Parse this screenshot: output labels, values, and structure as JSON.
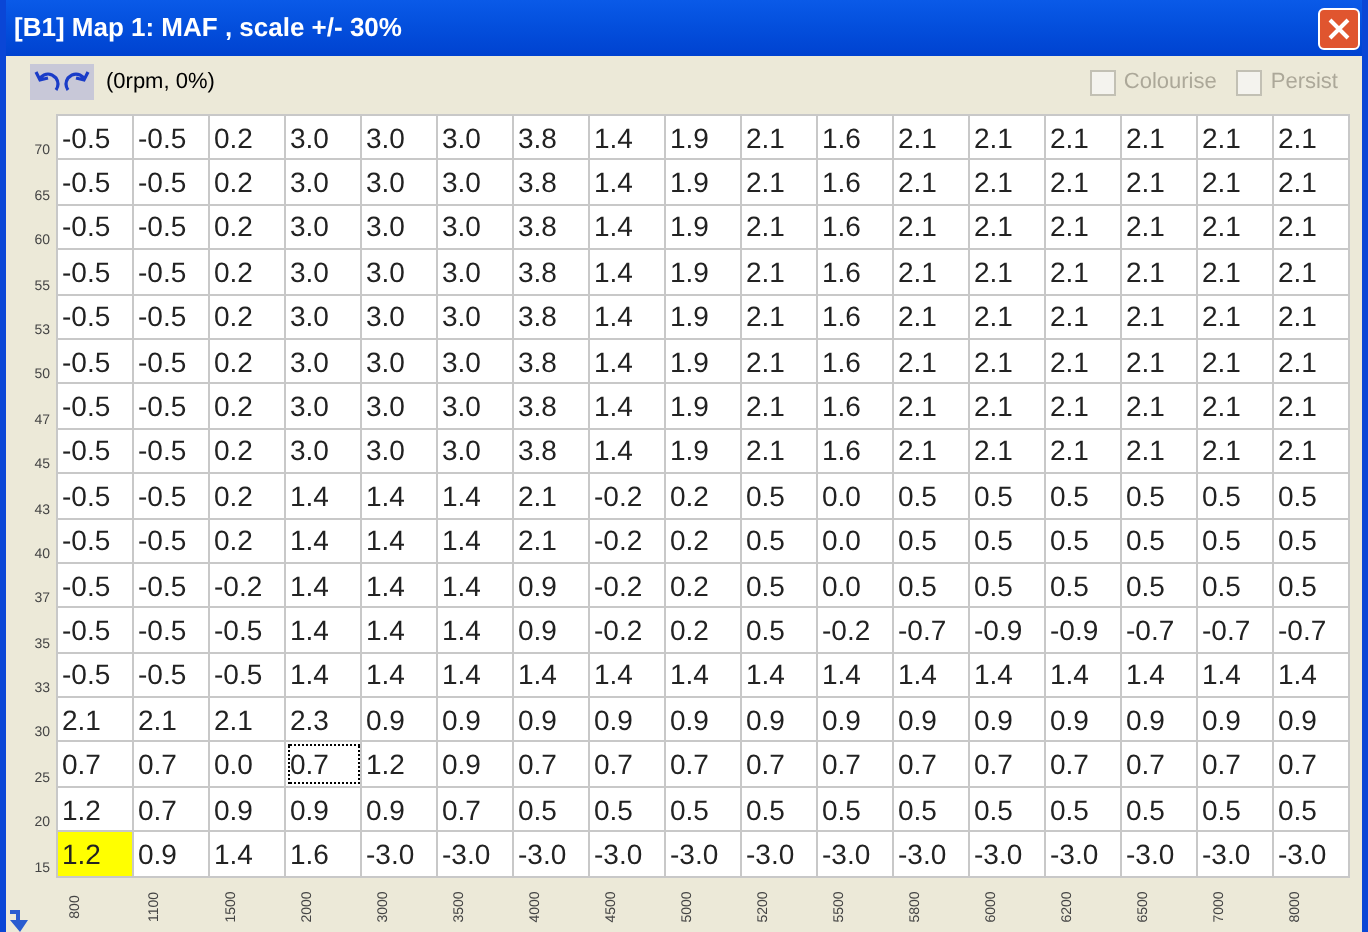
{
  "window": {
    "title": "[B1] Map 1: MAF , scale +/- 30%"
  },
  "toolbar": {
    "position": "(0rpm, 0%)",
    "options": [
      {
        "label": "Colourise",
        "checked": false,
        "disabled": true
      },
      {
        "label": "Persist",
        "checked": false,
        "disabled": true
      }
    ]
  },
  "rows": [
    {
      "label": "70",
      "cells": [
        {
          "text": "-0.5",
          "selected": false,
          "focused": false
        },
        {
          "text": "-0.5",
          "selected": false,
          "focused": false
        },
        {
          "text": "0.2",
          "selected": false,
          "focused": false
        },
        {
          "text": "3.0",
          "selected": false,
          "focused": false
        },
        {
          "text": "3.0",
          "selected": false,
          "focused": false
        },
        {
          "text": "3.0",
          "selected": false,
          "focused": false
        },
        {
          "text": "3.8",
          "selected": false,
          "focused": false
        },
        {
          "text": "1.4",
          "selected": false,
          "focused": false
        },
        {
          "text": "1.9",
          "selected": false,
          "focused": false
        },
        {
          "text": "2.1",
          "selected": false,
          "focused": false
        },
        {
          "text": "1.6",
          "selected": false,
          "focused": false
        },
        {
          "text": "2.1",
          "selected": false,
          "focused": false
        },
        {
          "text": "2.1",
          "selected": false,
          "focused": false
        },
        {
          "text": "2.1",
          "selected": false,
          "focused": false
        },
        {
          "text": "2.1",
          "selected": false,
          "focused": false
        },
        {
          "text": "2.1",
          "selected": false,
          "focused": false
        },
        {
          "text": "2.1",
          "selected": false,
          "focused": false
        }
      ]
    },
    {
      "label": "65",
      "cells": [
        {
          "text": "-0.5",
          "selected": false,
          "focused": false
        },
        {
          "text": "-0.5",
          "selected": false,
          "focused": false
        },
        {
          "text": "0.2",
          "selected": false,
          "focused": false
        },
        {
          "text": "3.0",
          "selected": false,
          "focused": false
        },
        {
          "text": "3.0",
          "selected": false,
          "focused": false
        },
        {
          "text": "3.0",
          "selected": false,
          "focused": false
        },
        {
          "text": "3.8",
          "selected": false,
          "focused": false
        },
        {
          "text": "1.4",
          "selected": false,
          "focused": false
        },
        {
          "text": "1.9",
          "selected": false,
          "focused": false
        },
        {
          "text": "2.1",
          "selected": false,
          "focused": false
        },
        {
          "text": "1.6",
          "selected": false,
          "focused": false
        },
        {
          "text": "2.1",
          "selected": false,
          "focused": false
        },
        {
          "text": "2.1",
          "selected": false,
          "focused": false
        },
        {
          "text": "2.1",
          "selected": false,
          "focused": false
        },
        {
          "text": "2.1",
          "selected": false,
          "focused": false
        },
        {
          "text": "2.1",
          "selected": false,
          "focused": false
        },
        {
          "text": "2.1",
          "selected": false,
          "focused": false
        }
      ]
    },
    {
      "label": "60",
      "cells": [
        {
          "text": "-0.5",
          "selected": false,
          "focused": false
        },
        {
          "text": "-0.5",
          "selected": false,
          "focused": false
        },
        {
          "text": "0.2",
          "selected": false,
          "focused": false
        },
        {
          "text": "3.0",
          "selected": false,
          "focused": false
        },
        {
          "text": "3.0",
          "selected": false,
          "focused": false
        },
        {
          "text": "3.0",
          "selected": false,
          "focused": false
        },
        {
          "text": "3.8",
          "selected": false,
          "focused": false
        },
        {
          "text": "1.4",
          "selected": false,
          "focused": false
        },
        {
          "text": "1.9",
          "selected": false,
          "focused": false
        },
        {
          "text": "2.1",
          "selected": false,
          "focused": false
        },
        {
          "text": "1.6",
          "selected": false,
          "focused": false
        },
        {
          "text": "2.1",
          "selected": false,
          "focused": false
        },
        {
          "text": "2.1",
          "selected": false,
          "focused": false
        },
        {
          "text": "2.1",
          "selected": false,
          "focused": false
        },
        {
          "text": "2.1",
          "selected": false,
          "focused": false
        },
        {
          "text": "2.1",
          "selected": false,
          "focused": false
        },
        {
          "text": "2.1",
          "selected": false,
          "focused": false
        }
      ]
    },
    {
      "label": "55",
      "cells": [
        {
          "text": "-0.5",
          "selected": false,
          "focused": false
        },
        {
          "text": "-0.5",
          "selected": false,
          "focused": false
        },
        {
          "text": "0.2",
          "selected": false,
          "focused": false
        },
        {
          "text": "3.0",
          "selected": false,
          "focused": false
        },
        {
          "text": "3.0",
          "selected": false,
          "focused": false
        },
        {
          "text": "3.0",
          "selected": false,
          "focused": false
        },
        {
          "text": "3.8",
          "selected": false,
          "focused": false
        },
        {
          "text": "1.4",
          "selected": false,
          "focused": false
        },
        {
          "text": "1.9",
          "selected": false,
          "focused": false
        },
        {
          "text": "2.1",
          "selected": false,
          "focused": false
        },
        {
          "text": "1.6",
          "selected": false,
          "focused": false
        },
        {
          "text": "2.1",
          "selected": false,
          "focused": false
        },
        {
          "text": "2.1",
          "selected": false,
          "focused": false
        },
        {
          "text": "2.1",
          "selected": false,
          "focused": false
        },
        {
          "text": "2.1",
          "selected": false,
          "focused": false
        },
        {
          "text": "2.1",
          "selected": false,
          "focused": false
        },
        {
          "text": "2.1",
          "selected": false,
          "focused": false
        }
      ]
    },
    {
      "label": "53",
      "cells": [
        {
          "text": "-0.5",
          "selected": false,
          "focused": false
        },
        {
          "text": "-0.5",
          "selected": false,
          "focused": false
        },
        {
          "text": "0.2",
          "selected": false,
          "focused": false
        },
        {
          "text": "3.0",
          "selected": false,
          "focused": false
        },
        {
          "text": "3.0",
          "selected": false,
          "focused": false
        },
        {
          "text": "3.0",
          "selected": false,
          "focused": false
        },
        {
          "text": "3.8",
          "selected": false,
          "focused": false
        },
        {
          "text": "1.4",
          "selected": false,
          "focused": false
        },
        {
          "text": "1.9",
          "selected": false,
          "focused": false
        },
        {
          "text": "2.1",
          "selected": false,
          "focused": false
        },
        {
          "text": "1.6",
          "selected": false,
          "focused": false
        },
        {
          "text": "2.1",
          "selected": false,
          "focused": false
        },
        {
          "text": "2.1",
          "selected": false,
          "focused": false
        },
        {
          "text": "2.1",
          "selected": false,
          "focused": false
        },
        {
          "text": "2.1",
          "selected": false,
          "focused": false
        },
        {
          "text": "2.1",
          "selected": false,
          "focused": false
        },
        {
          "text": "2.1",
          "selected": false,
          "focused": false
        }
      ]
    },
    {
      "label": "50",
      "cells": [
        {
          "text": "-0.5",
          "selected": false,
          "focused": false
        },
        {
          "text": "-0.5",
          "selected": false,
          "focused": false
        },
        {
          "text": "0.2",
          "selected": false,
          "focused": false
        },
        {
          "text": "3.0",
          "selected": false,
          "focused": false
        },
        {
          "text": "3.0",
          "selected": false,
          "focused": false
        },
        {
          "text": "3.0",
          "selected": false,
          "focused": false
        },
        {
          "text": "3.8",
          "selected": false,
          "focused": false
        },
        {
          "text": "1.4",
          "selected": false,
          "focused": false
        },
        {
          "text": "1.9",
          "selected": false,
          "focused": false
        },
        {
          "text": "2.1",
          "selected": false,
          "focused": false
        },
        {
          "text": "1.6",
          "selected": false,
          "focused": false
        },
        {
          "text": "2.1",
          "selected": false,
          "focused": false
        },
        {
          "text": "2.1",
          "selected": false,
          "focused": false
        },
        {
          "text": "2.1",
          "selected": false,
          "focused": false
        },
        {
          "text": "2.1",
          "selected": false,
          "focused": false
        },
        {
          "text": "2.1",
          "selected": false,
          "focused": false
        },
        {
          "text": "2.1",
          "selected": false,
          "focused": false
        }
      ]
    },
    {
      "label": "47",
      "cells": [
        {
          "text": "-0.5",
          "selected": false,
          "focused": false
        },
        {
          "text": "-0.5",
          "selected": false,
          "focused": false
        },
        {
          "text": "0.2",
          "selected": false,
          "focused": false
        },
        {
          "text": "3.0",
          "selected": false,
          "focused": false
        },
        {
          "text": "3.0",
          "selected": false,
          "focused": false
        },
        {
          "text": "3.0",
          "selected": false,
          "focused": false
        },
        {
          "text": "3.8",
          "selected": false,
          "focused": false
        },
        {
          "text": "1.4",
          "selected": false,
          "focused": false
        },
        {
          "text": "1.9",
          "selected": false,
          "focused": false
        },
        {
          "text": "2.1",
          "selected": false,
          "focused": false
        },
        {
          "text": "1.6",
          "selected": false,
          "focused": false
        },
        {
          "text": "2.1",
          "selected": false,
          "focused": false
        },
        {
          "text": "2.1",
          "selected": false,
          "focused": false
        },
        {
          "text": "2.1",
          "selected": false,
          "focused": false
        },
        {
          "text": "2.1",
          "selected": false,
          "focused": false
        },
        {
          "text": "2.1",
          "selected": false,
          "focused": false
        },
        {
          "text": "2.1",
          "selected": false,
          "focused": false
        }
      ]
    },
    {
      "label": "45",
      "cells": [
        {
          "text": "-0.5",
          "selected": false,
          "focused": false
        },
        {
          "text": "-0.5",
          "selected": false,
          "focused": false
        },
        {
          "text": "0.2",
          "selected": false,
          "focused": false
        },
        {
          "text": "3.0",
          "selected": false,
          "focused": false
        },
        {
          "text": "3.0",
          "selected": false,
          "focused": false
        },
        {
          "text": "3.0",
          "selected": false,
          "focused": false
        },
        {
          "text": "3.8",
          "selected": false,
          "focused": false
        },
        {
          "text": "1.4",
          "selected": false,
          "focused": false
        },
        {
          "text": "1.9",
          "selected": false,
          "focused": false
        },
        {
          "text": "2.1",
          "selected": false,
          "focused": false
        },
        {
          "text": "1.6",
          "selected": false,
          "focused": false
        },
        {
          "text": "2.1",
          "selected": false,
          "focused": false
        },
        {
          "text": "2.1",
          "selected": false,
          "focused": false
        },
        {
          "text": "2.1",
          "selected": false,
          "focused": false
        },
        {
          "text": "2.1",
          "selected": false,
          "focused": false
        },
        {
          "text": "2.1",
          "selected": false,
          "focused": false
        },
        {
          "text": "2.1",
          "selected": false,
          "focused": false
        }
      ]
    },
    {
      "label": "43",
      "cells": [
        {
          "text": "-0.5",
          "selected": false,
          "focused": false
        },
        {
          "text": "-0.5",
          "selected": false,
          "focused": false
        },
        {
          "text": "0.2",
          "selected": false,
          "focused": false
        },
        {
          "text": "1.4",
          "selected": false,
          "focused": false
        },
        {
          "text": "1.4",
          "selected": false,
          "focused": false
        },
        {
          "text": "1.4",
          "selected": false,
          "focused": false
        },
        {
          "text": "2.1",
          "selected": false,
          "focused": false
        },
        {
          "text": "-0.2",
          "selected": false,
          "focused": false
        },
        {
          "text": "0.2",
          "selected": false,
          "focused": false
        },
        {
          "text": "0.5",
          "selected": false,
          "focused": false
        },
        {
          "text": "0.0",
          "selected": false,
          "focused": false
        },
        {
          "text": "0.5",
          "selected": false,
          "focused": false
        },
        {
          "text": "0.5",
          "selected": false,
          "focused": false
        },
        {
          "text": "0.5",
          "selected": false,
          "focused": false
        },
        {
          "text": "0.5",
          "selected": false,
          "focused": false
        },
        {
          "text": "0.5",
          "selected": false,
          "focused": false
        },
        {
          "text": "0.5",
          "selected": false,
          "focused": false
        }
      ]
    },
    {
      "label": "40",
      "cells": [
        {
          "text": "-0.5",
          "selected": false,
          "focused": false
        },
        {
          "text": "-0.5",
          "selected": false,
          "focused": false
        },
        {
          "text": "0.2",
          "selected": false,
          "focused": false
        },
        {
          "text": "1.4",
          "selected": false,
          "focused": false
        },
        {
          "text": "1.4",
          "selected": false,
          "focused": false
        },
        {
          "text": "1.4",
          "selected": false,
          "focused": false
        },
        {
          "text": "2.1",
          "selected": false,
          "focused": false
        },
        {
          "text": "-0.2",
          "selected": false,
          "focused": false
        },
        {
          "text": "0.2",
          "selected": false,
          "focused": false
        },
        {
          "text": "0.5",
          "selected": false,
          "focused": false
        },
        {
          "text": "0.0",
          "selected": false,
          "focused": false
        },
        {
          "text": "0.5",
          "selected": false,
          "focused": false
        },
        {
          "text": "0.5",
          "selected": false,
          "focused": false
        },
        {
          "text": "0.5",
          "selected": false,
          "focused": false
        },
        {
          "text": "0.5",
          "selected": false,
          "focused": false
        },
        {
          "text": "0.5",
          "selected": false,
          "focused": false
        },
        {
          "text": "0.5",
          "selected": false,
          "focused": false
        }
      ]
    },
    {
      "label": "37",
      "cells": [
        {
          "text": "-0.5",
          "selected": false,
          "focused": false
        },
        {
          "text": "-0.5",
          "selected": false,
          "focused": false
        },
        {
          "text": "-0.2",
          "selected": false,
          "focused": false
        },
        {
          "text": "1.4",
          "selected": false,
          "focused": false
        },
        {
          "text": "1.4",
          "selected": false,
          "focused": false
        },
        {
          "text": "1.4",
          "selected": false,
          "focused": false
        },
        {
          "text": "0.9",
          "selected": false,
          "focused": false
        },
        {
          "text": "-0.2",
          "selected": false,
          "focused": false
        },
        {
          "text": "0.2",
          "selected": false,
          "focused": false
        },
        {
          "text": "0.5",
          "selected": false,
          "focused": false
        },
        {
          "text": "0.0",
          "selected": false,
          "focused": false
        },
        {
          "text": "0.5",
          "selected": false,
          "focused": false
        },
        {
          "text": "0.5",
          "selected": false,
          "focused": false
        },
        {
          "text": "0.5",
          "selected": false,
          "focused": false
        },
        {
          "text": "0.5",
          "selected": false,
          "focused": false
        },
        {
          "text": "0.5",
          "selected": false,
          "focused": false
        },
        {
          "text": "0.5",
          "selected": false,
          "focused": false
        }
      ]
    },
    {
      "label": "35",
      "cells": [
        {
          "text": "-0.5",
          "selected": false,
          "focused": false
        },
        {
          "text": "-0.5",
          "selected": false,
          "focused": false
        },
        {
          "text": "-0.5",
          "selected": false,
          "focused": false
        },
        {
          "text": "1.4",
          "selected": false,
          "focused": false
        },
        {
          "text": "1.4",
          "selected": false,
          "focused": false
        },
        {
          "text": "1.4",
          "selected": false,
          "focused": false
        },
        {
          "text": "0.9",
          "selected": false,
          "focused": false
        },
        {
          "text": "-0.2",
          "selected": false,
          "focused": false
        },
        {
          "text": "0.2",
          "selected": false,
          "focused": false
        },
        {
          "text": "0.5",
          "selected": false,
          "focused": false
        },
        {
          "text": "-0.2",
          "selected": false,
          "focused": false
        },
        {
          "text": "-0.7",
          "selected": false,
          "focused": false
        },
        {
          "text": "-0.9",
          "selected": false,
          "focused": false
        },
        {
          "text": "-0.9",
          "selected": false,
          "focused": false
        },
        {
          "text": "-0.7",
          "selected": false,
          "focused": false
        },
        {
          "text": "-0.7",
          "selected": false,
          "focused": false
        },
        {
          "text": "-0.7",
          "selected": false,
          "focused": false
        }
      ]
    },
    {
      "label": "33",
      "cells": [
        {
          "text": "-0.5",
          "selected": false,
          "focused": false
        },
        {
          "text": "-0.5",
          "selected": false,
          "focused": false
        },
        {
          "text": "-0.5",
          "selected": false,
          "focused": false
        },
        {
          "text": "1.4",
          "selected": false,
          "focused": false
        },
        {
          "text": "1.4",
          "selected": false,
          "focused": false
        },
        {
          "text": "1.4",
          "selected": false,
          "focused": false
        },
        {
          "text": "1.4",
          "selected": false,
          "focused": false
        },
        {
          "text": "1.4",
          "selected": false,
          "focused": false
        },
        {
          "text": "1.4",
          "selected": false,
          "focused": false
        },
        {
          "text": "1.4",
          "selected": false,
          "focused": false
        },
        {
          "text": "1.4",
          "selected": false,
          "focused": false
        },
        {
          "text": "1.4",
          "selected": false,
          "focused": false
        },
        {
          "text": "1.4",
          "selected": false,
          "focused": false
        },
        {
          "text": "1.4",
          "selected": false,
          "focused": false
        },
        {
          "text": "1.4",
          "selected": false,
          "focused": false
        },
        {
          "text": "1.4",
          "selected": false,
          "focused": false
        },
        {
          "text": "1.4",
          "selected": false,
          "focused": false
        }
      ]
    },
    {
      "label": "30",
      "cells": [
        {
          "text": "2.1",
          "selected": false,
          "focused": false
        },
        {
          "text": "2.1",
          "selected": false,
          "focused": false
        },
        {
          "text": "2.1",
          "selected": false,
          "focused": false
        },
        {
          "text": "2.3",
          "selected": false,
          "focused": false
        },
        {
          "text": "0.9",
          "selected": false,
          "focused": false
        },
        {
          "text": "0.9",
          "selected": false,
          "focused": false
        },
        {
          "text": "0.9",
          "selected": false,
          "focused": false
        },
        {
          "text": "0.9",
          "selected": false,
          "focused": false
        },
        {
          "text": "0.9",
          "selected": false,
          "focused": false
        },
        {
          "text": "0.9",
          "selected": false,
          "focused": false
        },
        {
          "text": "0.9",
          "selected": false,
          "focused": false
        },
        {
          "text": "0.9",
          "selected": false,
          "focused": false
        },
        {
          "text": "0.9",
          "selected": false,
          "focused": false
        },
        {
          "text": "0.9",
          "selected": false,
          "focused": false
        },
        {
          "text": "0.9",
          "selected": false,
          "focused": false
        },
        {
          "text": "0.9",
          "selected": false,
          "focused": false
        },
        {
          "text": "0.9",
          "selected": false,
          "focused": false
        }
      ]
    },
    {
      "label": "25",
      "cells": [
        {
          "text": "0.7",
          "selected": false,
          "focused": false
        },
        {
          "text": "0.7",
          "selected": false,
          "focused": false
        },
        {
          "text": "0.0",
          "selected": false,
          "focused": false
        },
        {
          "text": "0.7",
          "selected": false,
          "focused": true
        },
        {
          "text": "1.2",
          "selected": false,
          "focused": false
        },
        {
          "text": "0.9",
          "selected": false,
          "focused": false
        },
        {
          "text": "0.7",
          "selected": false,
          "focused": false
        },
        {
          "text": "0.7",
          "selected": false,
          "focused": false
        },
        {
          "text": "0.7",
          "selected": false,
          "focused": false
        },
        {
          "text": "0.7",
          "selected": false,
          "focused": false
        },
        {
          "text": "0.7",
          "selected": false,
          "focused": false
        },
        {
          "text": "0.7",
          "selected": false,
          "focused": false
        },
        {
          "text": "0.7",
          "selected": false,
          "focused": false
        },
        {
          "text": "0.7",
          "selected": false,
          "focused": false
        },
        {
          "text": "0.7",
          "selected": false,
          "focused": false
        },
        {
          "text": "0.7",
          "selected": false,
          "focused": false
        },
        {
          "text": "0.7",
          "selected": false,
          "focused": false
        }
      ]
    },
    {
      "label": "20",
      "cells": [
        {
          "text": "1.2",
          "selected": false,
          "focused": false
        },
        {
          "text": "0.7",
          "selected": false,
          "focused": false
        },
        {
          "text": "0.9",
          "selected": false,
          "focused": false
        },
        {
          "text": "0.9",
          "selected": false,
          "focused": false
        },
        {
          "text": "0.9",
          "selected": false,
          "focused": false
        },
        {
          "text": "0.7",
          "selected": false,
          "focused": false
        },
        {
          "text": "0.5",
          "selected": false,
          "focused": false
        },
        {
          "text": "0.5",
          "selected": false,
          "focused": false
        },
        {
          "text": "0.5",
          "selected": false,
          "focused": false
        },
        {
          "text": "0.5",
          "selected": false,
          "focused": false
        },
        {
          "text": "0.5",
          "selected": false,
          "focused": false
        },
        {
          "text": "0.5",
          "selected": false,
          "focused": false
        },
        {
          "text": "0.5",
          "selected": false,
          "focused": false
        },
        {
          "text": "0.5",
          "selected": false,
          "focused": false
        },
        {
          "text": "0.5",
          "selected": false,
          "focused": false
        },
        {
          "text": "0.5",
          "selected": false,
          "focused": false
        },
        {
          "text": "0.5",
          "selected": false,
          "focused": false
        }
      ]
    },
    {
      "label": "15",
      "cells": [
        {
          "text": "1.2",
          "selected": true,
          "focused": false
        },
        {
          "text": "0.9",
          "selected": false,
          "focused": false
        },
        {
          "text": "1.4",
          "selected": false,
          "focused": false
        },
        {
          "text": "1.6",
          "selected": false,
          "focused": false
        },
        {
          "text": "-3.0",
          "selected": false,
          "focused": false
        },
        {
          "text": "-3.0",
          "selected": false,
          "focused": false
        },
        {
          "text": "-3.0",
          "selected": false,
          "focused": false
        },
        {
          "text": "-3.0",
          "selected": false,
          "focused": false
        },
        {
          "text": "-3.0",
          "selected": false,
          "focused": false
        },
        {
          "text": "-3.0",
          "selected": false,
          "focused": false
        },
        {
          "text": "-3.0",
          "selected": false,
          "focused": false
        },
        {
          "text": "-3.0",
          "selected": false,
          "focused": false
        },
        {
          "text": "-3.0",
          "selected": false,
          "focused": false
        },
        {
          "text": "-3.0",
          "selected": false,
          "focused": false
        },
        {
          "text": "-3.0",
          "selected": false,
          "focused": false
        },
        {
          "text": "-3.0",
          "selected": false,
          "focused": false
        },
        {
          "text": "-3.0",
          "selected": false,
          "focused": false
        }
      ]
    }
  ],
  "columns": [
    "800",
    "1100",
    "1500",
    "2000",
    "3000",
    "3500",
    "4000",
    "4500",
    "5000",
    "5200",
    "5500",
    "5800",
    "6000",
    "6200",
    "6500",
    "7000",
    "8000"
  ]
}
